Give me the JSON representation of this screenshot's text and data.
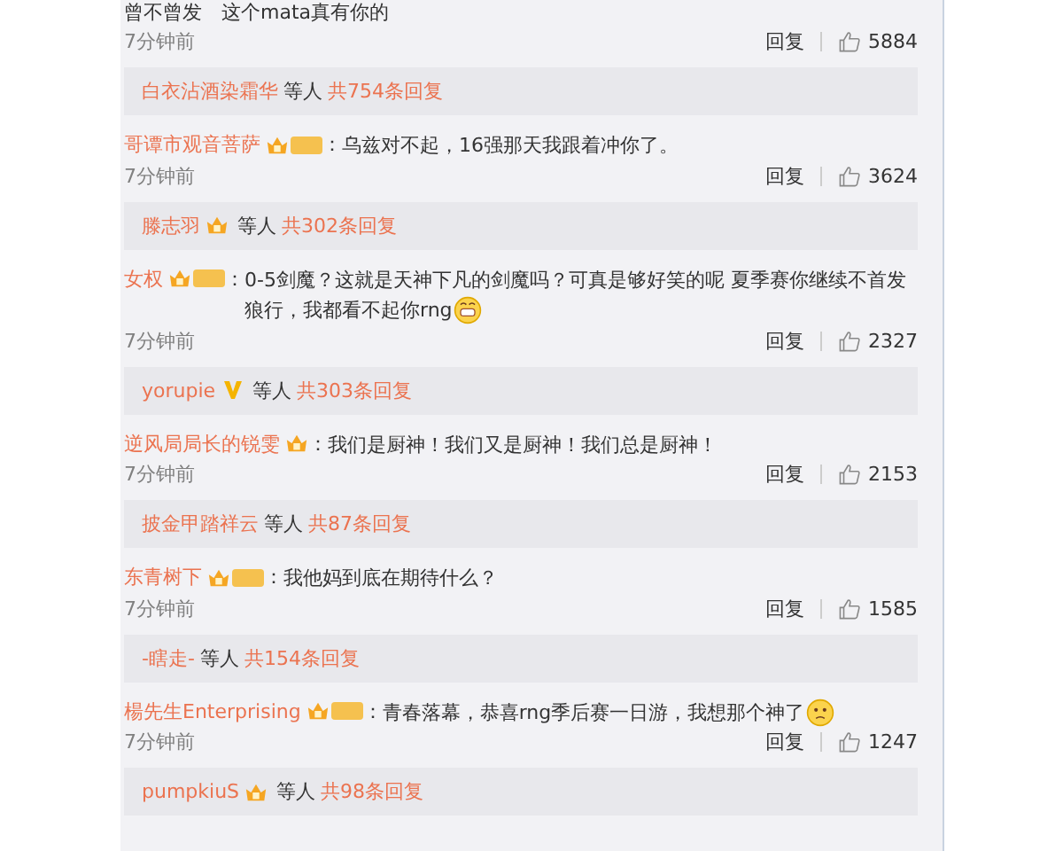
{
  "items": [
    {
      "kind": "comment",
      "text": "曾不曾发　这个mata真有你的",
      "time": "7分钟前",
      "reply": "回复",
      "likes": "5884"
    },
    {
      "kind": "replies",
      "user": "白衣沾酒染霜华",
      "suffix": "等人",
      "count": "共754条回复"
    },
    {
      "kind": "comment",
      "user": "哥谭市观音菩萨",
      "crown": true,
      "tag": true,
      "colon": "：",
      "text": "乌兹对不起，16强那天我跟着冲你了。",
      "time": "7分钟前",
      "reply": "回复",
      "likes": "3624"
    },
    {
      "kind": "replies",
      "user": "滕志羽",
      "crown": true,
      "suffix": "等人",
      "count": "共302条回复"
    },
    {
      "kind": "comment",
      "user": "女权",
      "crown": true,
      "tag": true,
      "colon": "：",
      "text": "0-5剑魔？这就是天神下凡的剑魔吗？可真是够好笑的呢 夏季赛你继续不首发狼行，我都看不起你rng",
      "grin_emoji": true,
      "time": "7分钟前",
      "reply": "回复",
      "likes": "2327"
    },
    {
      "kind": "replies",
      "user": "yorupie",
      "verified": true,
      "suffix": "等人",
      "count": "共303条回复"
    },
    {
      "kind": "comment",
      "user": "逆风局局长的锐雯",
      "crown": true,
      "colon": "：",
      "text": "我们是厨神！我们又是厨神！我们总是厨神！",
      "time": "7分钟前",
      "reply": "回复",
      "likes": "2153"
    },
    {
      "kind": "replies",
      "user": "披金甲踏祥云",
      "suffix": "等人",
      "count": "共87条回复"
    },
    {
      "kind": "comment",
      "user": "东青树下",
      "crown": true,
      "tag": true,
      "colon": "：",
      "text": "我他妈到底在期待什么？",
      "time": "7分钟前",
      "reply": "回复",
      "likes": "1585"
    },
    {
      "kind": "replies",
      "user": "-瞎走-",
      "suffix": "等人",
      "count": "共154条回复"
    },
    {
      "kind": "comment",
      "user": "楊先生Enterprising",
      "crown": true,
      "tag": true,
      "colon": "：",
      "text": "青春落幕，恭喜rng季后赛一日游，我想那个神了",
      "sad_emoji": true,
      "time": "7分钟前",
      "reply": "回复",
      "likes": "1247"
    },
    {
      "kind": "replies",
      "user": "pumpkiuS",
      "crown": true,
      "suffix": "等人",
      "count": "共98条回复"
    }
  ]
}
